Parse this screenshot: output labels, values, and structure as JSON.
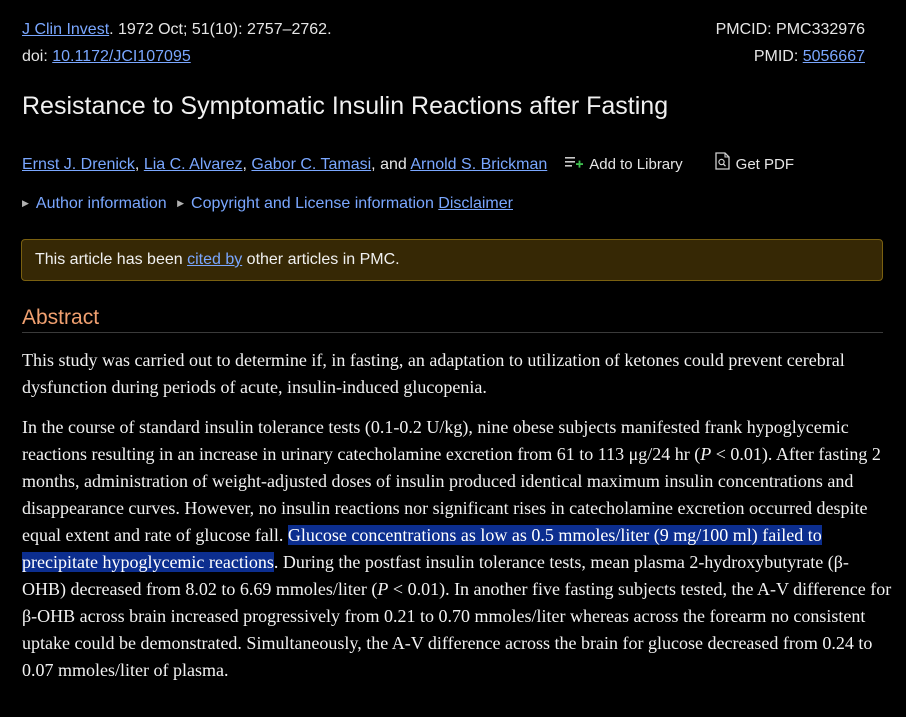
{
  "citation": {
    "journal": "J Clin Invest",
    "details": ". 1972 Oct; 51(10): 2757–2762.",
    "doi_label": "doi: ",
    "doi": "10.1172/JCI107095"
  },
  "ids": {
    "pmcid_label": "PMCID: ",
    "pmcid": "PMC332976",
    "pmid_label": "PMID: ",
    "pmid": "5056667"
  },
  "title": "Resistance to Symptomatic Insulin Reactions after Fasting",
  "authors": [
    "Ernst J. Drenick",
    "Lia C. Alvarez",
    "Gabor C. Tamasi",
    "Arnold S. Brickman"
  ],
  "authors_sep": [
    ", ",
    ", ",
    ", and "
  ],
  "tools": {
    "add_library": "Add to Library",
    "get_pdf": "Get PDF"
  },
  "info": {
    "author_information": "Author information",
    "copyright": "Copyright and License information",
    "disclaimer": "Disclaimer"
  },
  "notice": {
    "before": "This article has been ",
    "link": "cited by",
    "after": " other articles in PMC."
  },
  "abstract": {
    "heading": "Abstract",
    "p1": "This study was carried out to determine if, in fasting, an adaptation to utilization of ketones could prevent cerebral dysfunction during periods of acute, insulin-induced glucopenia.",
    "p2a": "In the course of standard insulin tolerance tests (0.1-0.2 U/kg), nine obese subjects manifested frank hypoglycemic reactions resulting in an increase in urinary catecholamine excretion from 61 to 113 μg/24 hr (",
    "p_symbol": "P",
    "p2b": " < 0.01). After fasting 2 months, administration of weight-adjusted doses of insulin produced identical maximum insulin concentrations and disappearance curves. However, no insulin reactions nor significant rises in catecholamine excretion occurred despite equal extent and rate of glucose fall. ",
    "p2_highlight": "Glucose concentrations as low as 0.5 mmoles/liter (9 mg/100 ml) failed to precipitate hypoglycemic reactions",
    "p2c": ". During the postfast insulin tolerance tests, mean plasma 2-hydroxybutyrate (β-OHB) decreased from 8.02 to 6.69 mmoles/liter (",
    "p2d": " < 0.01). In another five fasting subjects tested, the A-V difference for β-OHB across brain increased progressively from 0.21 to 0.70 mmoles/liter whereas across the forearm no consistent uptake could be demonstrated. Simultaneously, the A-V difference across the brain for glucose decreased from 0.24 to 0.07 mmoles/liter of plasma."
  },
  "colors": {
    "background": "#000000",
    "link": "#7aa7ff",
    "heading_accent": "#f0a070",
    "notice_bg": "#362805",
    "highlight_bg": "#0c2e8f"
  },
  "icons": [
    "add-to-library-icon",
    "pdf-icon",
    "expand-triangle-icon"
  ]
}
